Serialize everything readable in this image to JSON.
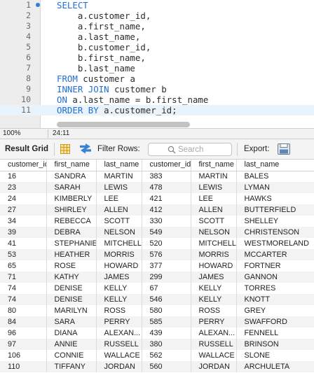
{
  "editor": {
    "lines": [
      {
        "num": "1",
        "kw": "SELECT",
        "text": ""
      },
      {
        "num": "2",
        "kw": "",
        "text": "    a.customer_id,"
      },
      {
        "num": "3",
        "kw": "",
        "text": "    a.first_name,"
      },
      {
        "num": "4",
        "kw": "",
        "text": "    a.last_name,"
      },
      {
        "num": "5",
        "kw": "",
        "text": "    b.customer_id,"
      },
      {
        "num": "6",
        "kw": "",
        "text": "    b.first_name,"
      },
      {
        "num": "7",
        "kw": "",
        "text": "    b.last_name"
      },
      {
        "num": "8",
        "kw": "FROM",
        "text": " customer a"
      },
      {
        "num": "9",
        "kw": "INNER JOIN",
        "text": " customer b"
      },
      {
        "num": "10",
        "kw": "ON",
        "text": " a.last_name = b.first_name"
      },
      {
        "num": "11",
        "kw": "ORDER BY",
        "text": " a.customer_id;"
      }
    ]
  },
  "statusbar": {
    "zoom": "100%",
    "position": "24:11"
  },
  "toolbar": {
    "result_grid_label": "Result Grid",
    "filter_rows_label": "Filter Rows:",
    "search_placeholder": "Search",
    "export_label": "Export:",
    "icons": [
      "grid-icon",
      "refresh-icon",
      "search-icon",
      "export-icon"
    ]
  },
  "grid": {
    "columns": [
      "customer_id",
      "first_name",
      "last_name",
      "customer_id",
      "first_name",
      "last_name"
    ],
    "rows": [
      [
        "16",
        "SANDRA",
        "MARTIN",
        "383",
        "MARTIN",
        "BALES"
      ],
      [
        "23",
        "SARAH",
        "LEWIS",
        "478",
        "LEWIS",
        "LYMAN"
      ],
      [
        "24",
        "KIMBERLY",
        "LEE",
        "421",
        "LEE",
        "HAWKS"
      ],
      [
        "27",
        "SHIRLEY",
        "ALLEN",
        "412",
        "ALLEN",
        "BUTTERFIELD"
      ],
      [
        "34",
        "REBECCA",
        "SCOTT",
        "330",
        "SCOTT",
        "SHELLEY"
      ],
      [
        "39",
        "DEBRA",
        "NELSON",
        "549",
        "NELSON",
        "CHRISTENSON"
      ],
      [
        "41",
        "STEPHANIE",
        "MITCHELL",
        "520",
        "MITCHELL",
        "WESTMORELAND"
      ],
      [
        "53",
        "HEATHER",
        "MORRIS",
        "576",
        "MORRIS",
        "MCCARTER"
      ],
      [
        "65",
        "ROSE",
        "HOWARD",
        "377",
        "HOWARD",
        "FORTNER"
      ],
      [
        "71",
        "KATHY",
        "JAMES",
        "299",
        "JAMES",
        "GANNON"
      ],
      [
        "74",
        "DENISE",
        "KELLY",
        "67",
        "KELLY",
        "TORRES"
      ],
      [
        "74",
        "DENISE",
        "KELLY",
        "546",
        "KELLY",
        "KNOTT"
      ],
      [
        "80",
        "MARILYN",
        "ROSS",
        "580",
        "ROSS",
        "GREY"
      ],
      [
        "84",
        "SARA",
        "PERRY",
        "585",
        "PERRY",
        "SWAFFORD"
      ],
      [
        "96",
        "DIANA",
        "ALEXAN...",
        "439",
        "ALEXAN...",
        "FENNELL"
      ],
      [
        "97",
        "ANNIE",
        "RUSSELL",
        "380",
        "RUSSELL",
        "BRINSON"
      ],
      [
        "106",
        "CONNIE",
        "WALLACE",
        "562",
        "WALLACE",
        "SLONE"
      ],
      [
        "110",
        "TIFFANY",
        "JORDAN",
        "560",
        "JORDAN",
        "ARCHULETA"
      ]
    ]
  },
  "colors": {
    "keyword": "#1f6fd6",
    "current_line": "#e9f3fb",
    "line_marker": "#2f7fd8",
    "toolbar_icon": "#3a82d4"
  }
}
